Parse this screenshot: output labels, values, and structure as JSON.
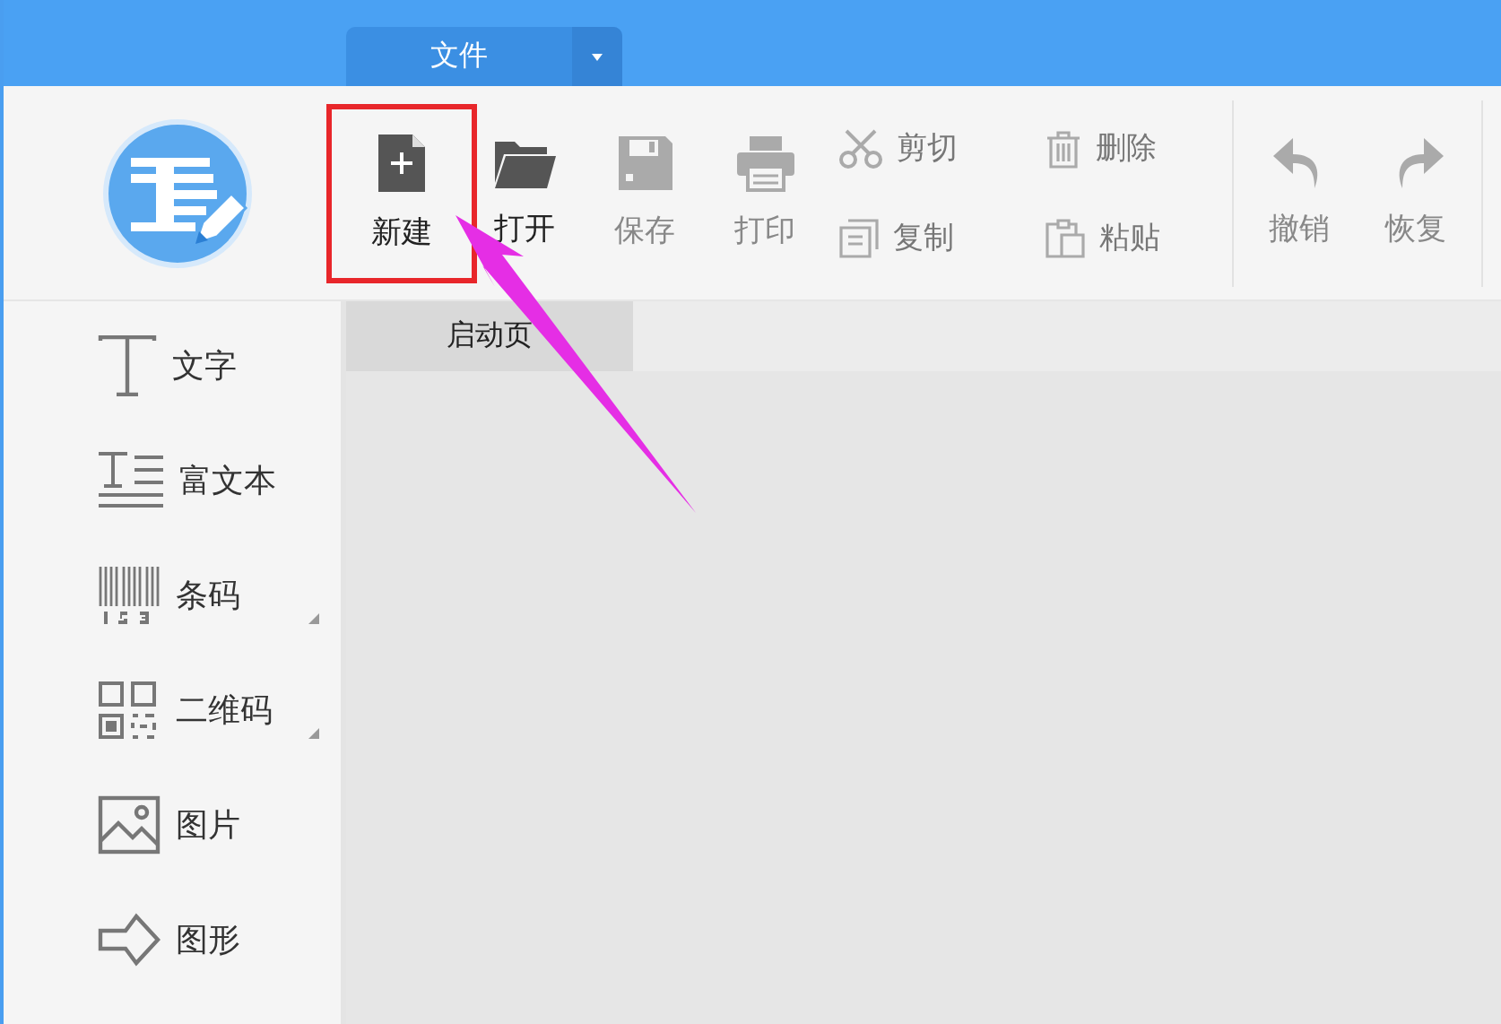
{
  "menu_tab": {
    "label": "文件"
  },
  "toolbar": {
    "file_buttons": [
      {
        "label": "新建",
        "disabled": false,
        "highlighted": true
      },
      {
        "label": "打开",
        "disabled": false,
        "highlighted": false
      },
      {
        "label": "保存",
        "disabled": true,
        "highlighted": false
      },
      {
        "label": "打印",
        "disabled": true,
        "highlighted": false
      }
    ],
    "edit_buttons": [
      {
        "label": "剪切",
        "disabled": true
      },
      {
        "label": "删除",
        "disabled": true
      },
      {
        "label": "复制",
        "disabled": true
      },
      {
        "label": "粘贴",
        "disabled": true
      }
    ],
    "history_buttons": [
      {
        "label": "撤销",
        "disabled": true
      },
      {
        "label": "恢复",
        "disabled": true
      }
    ]
  },
  "sidebar": {
    "items": [
      {
        "label": "文字",
        "has_submenu": false
      },
      {
        "label": "富文本",
        "has_submenu": false
      },
      {
        "label": "条码",
        "has_submenu": true
      },
      {
        "label": "二维码",
        "has_submenu": true
      },
      {
        "label": "图片",
        "has_submenu": false
      },
      {
        "label": "图形",
        "has_submenu": false
      }
    ]
  },
  "doc_tabs": [
    {
      "label": "启动页",
      "selected": true
    }
  ]
}
